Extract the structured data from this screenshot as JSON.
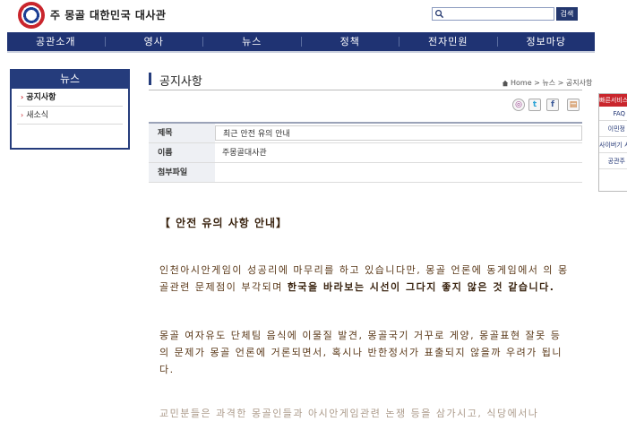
{
  "header": {
    "site_title": "주 몽골 대한민국 대사관",
    "search_value": "",
    "search_button": "검색"
  },
  "nav": {
    "items": [
      "공관소개",
      "영사",
      "뉴스",
      "정책",
      "전자민원",
      "정보마당"
    ]
  },
  "sidebar": {
    "title": "뉴스",
    "items": [
      {
        "label": "공지사항",
        "active": true
      },
      {
        "label": "새소식",
        "active": false
      }
    ]
  },
  "page": {
    "title": "공지사항",
    "breadcrumb": "Home > 뉴스 > 공지사항"
  },
  "share": {
    "icons": [
      "me2day-icon",
      "twitter-icon",
      "facebook-icon",
      "print-icon"
    ],
    "labels": [
      "◎",
      "t",
      "f",
      "▤"
    ]
  },
  "info": {
    "subject_label": "제목",
    "subject_value": "최근 안전 유의 안내",
    "name_label": "이름",
    "name_value": "주몽골대사관",
    "attachment_label": "첨부파일",
    "attachment_value": ""
  },
  "article": {
    "heading": "【 안전 유의 사항 안내】",
    "para1_normal": "인천아시안게임이 성공리에 마무리를 하고 있습니다만, 몽골 언론에 동게임에서 의 몽골관련 문제점이 부각되며 ",
    "para1_bold": "한국을 바라보는 시선이 그다지 좋지 않은 것 같습니다.",
    "para2": "몽골 여자유도 단체팀 음식에 이물질 발견, 몽골국기 거꾸로 게양, 몽골표현 잘못 등의 문제가 몽골 언론에 거론되면서, 혹시나 반한정서가 표출되지 않을까 우려가 됩니다.",
    "para3": "교민분들은 과격한 몽골인들과 아시안게임관련 논쟁 등을 삼가시고, 식당에서나"
  },
  "quick_menu": {
    "title": "빠른서비스",
    "items": [
      "FAQ",
      "이민정",
      "사이버기 서비스",
      "공관주"
    ]
  },
  "colors": {
    "navy": "#1f3373",
    "accent_red": "#c9252c",
    "article_text": "#5a3818"
  }
}
